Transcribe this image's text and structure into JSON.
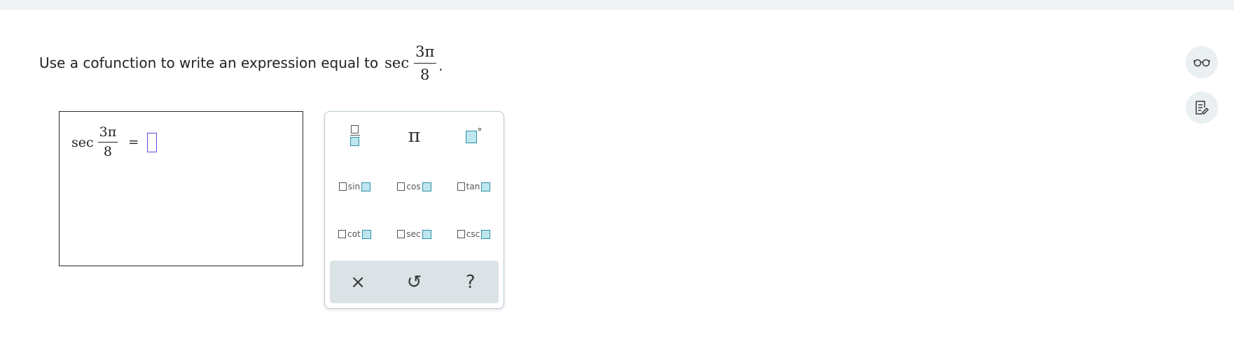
{
  "question": {
    "prompt": "Use a cofunction to write an expression equal to",
    "function": "sec",
    "numerator": "3π",
    "denominator": "8",
    "period": "."
  },
  "answer": {
    "function": "sec",
    "numerator": "3π",
    "denominator": "8",
    "equals": "="
  },
  "palette": {
    "row1": [
      {
        "icon": "fraction-icon"
      },
      {
        "label": "π",
        "icon": "pi-icon"
      },
      {
        "label": "°",
        "icon": "degree-icon"
      }
    ],
    "trig_row1": [
      "sin",
      "cos",
      "tan"
    ],
    "trig_row2": [
      "cot",
      "sec",
      "csc"
    ],
    "footer": [
      {
        "label": "×",
        "icon": "clear-icon"
      },
      {
        "label": "↺",
        "icon": "undo-icon"
      },
      {
        "label": "?",
        "icon": "help-icon"
      }
    ]
  },
  "side_tools": [
    {
      "icon": "glasses-icon"
    },
    {
      "icon": "notes-icon"
    }
  ],
  "colors": {
    "topbar": "#f0f2f3",
    "answer_slot": "#5b4fd9",
    "palette_box": "#2a8ea6",
    "palette_box_fill": "#bfe6ef",
    "footer_bg": "#dbe3e7",
    "side_button_bg": "#eaeff2"
  }
}
